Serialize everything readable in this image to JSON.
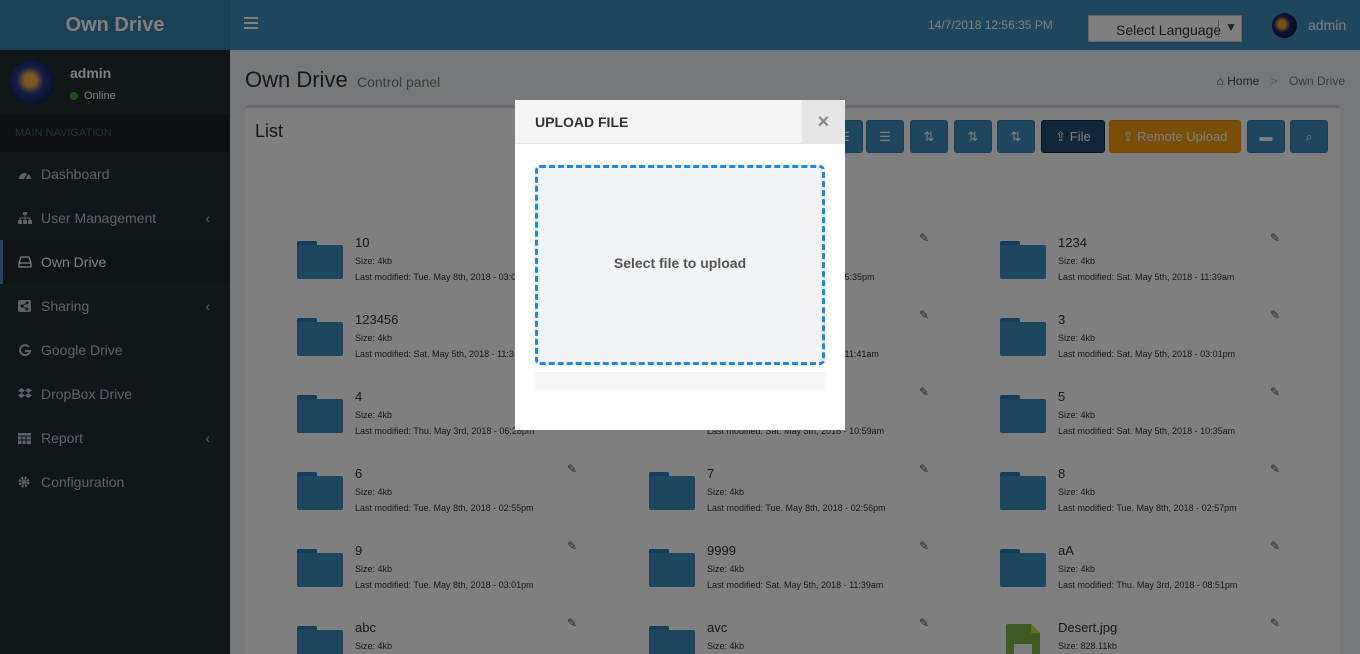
{
  "app": {
    "logo": "Own Drive"
  },
  "header": {
    "datetime": "14/7/2018 12:56:35 PM",
    "language_select": "Select Language",
    "user": "admin"
  },
  "sidebar": {
    "user": {
      "name": "admin",
      "status": "Online"
    },
    "nav_header": "MAIN NAVIGATION",
    "items": [
      {
        "label": "Dashboard",
        "icon": "dashboard-icon",
        "active": false,
        "submenu": false
      },
      {
        "label": "User Management",
        "icon": "sitemap-icon",
        "active": false,
        "submenu": true
      },
      {
        "label": "Own Drive",
        "icon": "hdd-icon",
        "active": true,
        "submenu": false
      },
      {
        "label": "Sharing",
        "icon": "share-icon",
        "active": false,
        "submenu": true
      },
      {
        "label": "Google Drive",
        "icon": "google-icon",
        "active": false,
        "submenu": false
      },
      {
        "label": "DropBox Drive",
        "icon": "dropbox-icon",
        "active": false,
        "submenu": false
      },
      {
        "label": "Report",
        "icon": "calendar-icon",
        "active": false,
        "submenu": true
      },
      {
        "label": "Configuration",
        "icon": "gear-icon",
        "active": false,
        "submenu": false
      }
    ]
  },
  "content": {
    "title": "Own Drive",
    "subtitle": "Control panel",
    "breadcrumb": {
      "home": "Home",
      "current": "Own Drive"
    },
    "box_title": "List",
    "toolbar": {
      "file_label": "File",
      "remote_upload_label": "Remote Upload"
    }
  },
  "files": [
    {
      "name": "10",
      "size": "Size: 4kb",
      "modified": "Last modified: Tue. May 8th, 2018 - 03:0"
    },
    {
      "name": "",
      "size": "",
      "modified": "- 05:35pm"
    },
    {
      "name": "1234",
      "size": "Size: 4kb",
      "modified": "Last modified: Sat. May 5th, 2018 - 11:39am"
    },
    {
      "name": "123456",
      "size": "Size: 4kb",
      "modified": "Last modified: Sat. May 5th, 2018 - 11:3"
    },
    {
      "name": "",
      "size": "",
      "modified": "- 11:41am"
    },
    {
      "name": "3",
      "size": "Size: 4kb",
      "modified": "Last modified: Sat. May 5th, 2018 - 03:01pm"
    },
    {
      "name": "4",
      "size": "Size: 4kb",
      "modified": "Last modified: Thu. May 3rd, 2018 - 06:28pm"
    },
    {
      "name": "",
      "size": "",
      "modified": "Last modified: Sat. May 5th, 2018 - 10:59am"
    },
    {
      "name": "5",
      "size": "Size: 4kb",
      "modified": "Last modified: Sat. May 5th, 2018 - 10:35am"
    },
    {
      "name": "6",
      "size": "Size: 4kb",
      "modified": "Last modified: Tue. May 8th, 2018 - 02:55pm"
    },
    {
      "name": "7",
      "size": "Size: 4kb",
      "modified": "Last modified: Tue. May 8th, 2018 - 02:56pm"
    },
    {
      "name": "8",
      "size": "Size: 4kb",
      "modified": "Last modified: Tue. May 8th, 2018 - 02:57pm"
    },
    {
      "name": "9",
      "size": "Size: 4kb",
      "modified": "Last modified: Tue. May 8th, 2018 - 03:01pm"
    },
    {
      "name": "9999",
      "size": "Size: 4kb",
      "modified": "Last modified: Sat. May 5th, 2018 - 11:39am"
    },
    {
      "name": "aA",
      "size": "Size: 4kb",
      "modified": "Last modified: Thu. May 3rd, 2018 - 08:51pm"
    },
    {
      "name": "abc",
      "size": "Size: 4kb",
      "modified": ""
    },
    {
      "name": "avc",
      "size": "Size: 4kb",
      "modified": ""
    },
    {
      "name": "Desert.jpg",
      "size": "Size: 828.11kb",
      "modified": ""
    }
  ],
  "modal": {
    "title": "UPLOAD FILE",
    "close": "×",
    "dropzone_text": "Select file to upload",
    "progress": 0
  },
  "colors": {
    "primary": "#3c8dbc",
    "logo_bg": "#367fa9",
    "sidebar_bg": "#222d32",
    "dropzone_border": "#1e88e5",
    "warning": "#f39c12"
  }
}
